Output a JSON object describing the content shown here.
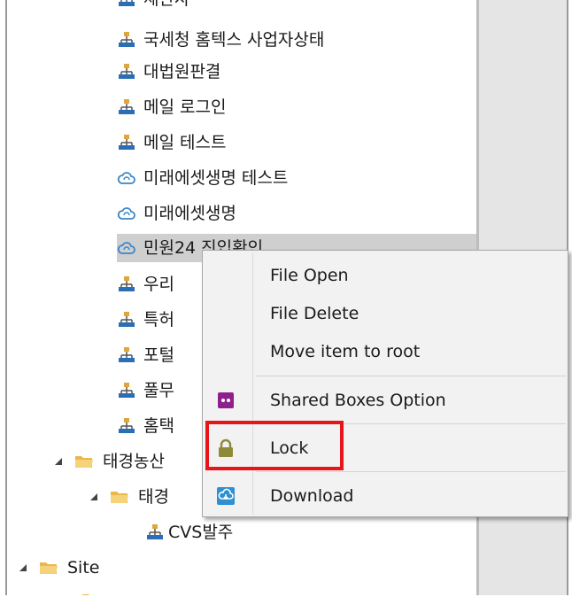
{
  "tree": {
    "items": [
      {
        "label": "세관사",
        "icon": "network-icon"
      },
      {
        "label": "국세청 홈텍스 사업자상태",
        "icon": "network-icon"
      },
      {
        "label": "대법원판결",
        "icon": "network-icon"
      },
      {
        "label": "메일 로그인",
        "icon": "network-icon"
      },
      {
        "label": "메일 테스트",
        "icon": "network-icon"
      },
      {
        "label": "미래에셋생명 테스트",
        "icon": "cloud-icon"
      },
      {
        "label": "미래에셋생명",
        "icon": "cloud-icon"
      },
      {
        "label": "민원24 진입확인",
        "icon": "cloud-icon"
      },
      {
        "label": "우리",
        "icon": "network-icon"
      },
      {
        "label": "특허",
        "icon": "network-icon"
      },
      {
        "label": "포털",
        "icon": "network-icon"
      },
      {
        "label": "풀무",
        "icon": "network-icon"
      },
      {
        "label": "홈택",
        "icon": "network-icon"
      },
      {
        "label": "태경농산",
        "icon": "folder-icon"
      },
      {
        "label": "태경",
        "icon": "folder-icon"
      },
      {
        "label": "CVS발주",
        "icon": "network-icon"
      },
      {
        "label": "Site",
        "icon": "folder-icon"
      },
      {
        "label": "",
        "icon": "folder-icon"
      }
    ]
  },
  "context_menu": {
    "items": [
      {
        "label": "File Open",
        "icon": ""
      },
      {
        "label": "File Delete",
        "icon": ""
      },
      {
        "label": "Move item to root",
        "icon": ""
      },
      {
        "label": "Shared Boxes Option",
        "icon": "shared-boxes-icon"
      },
      {
        "label": "Lock",
        "icon": "lock-icon"
      },
      {
        "label": "Download",
        "icon": "download-icon"
      }
    ],
    "highlighted": "Lock"
  },
  "colors": {
    "network_icon": "#2a6fb5",
    "cloud_icon": "#3b86c8",
    "folder_icon": "#e9b74a",
    "selection": "#cfcfcf",
    "highlight_box": "#e8141b",
    "shared_boxes_icon": "#8e1f8c",
    "lock_icon": "#8f8a3a",
    "download_icon": "#2f8fd1"
  }
}
